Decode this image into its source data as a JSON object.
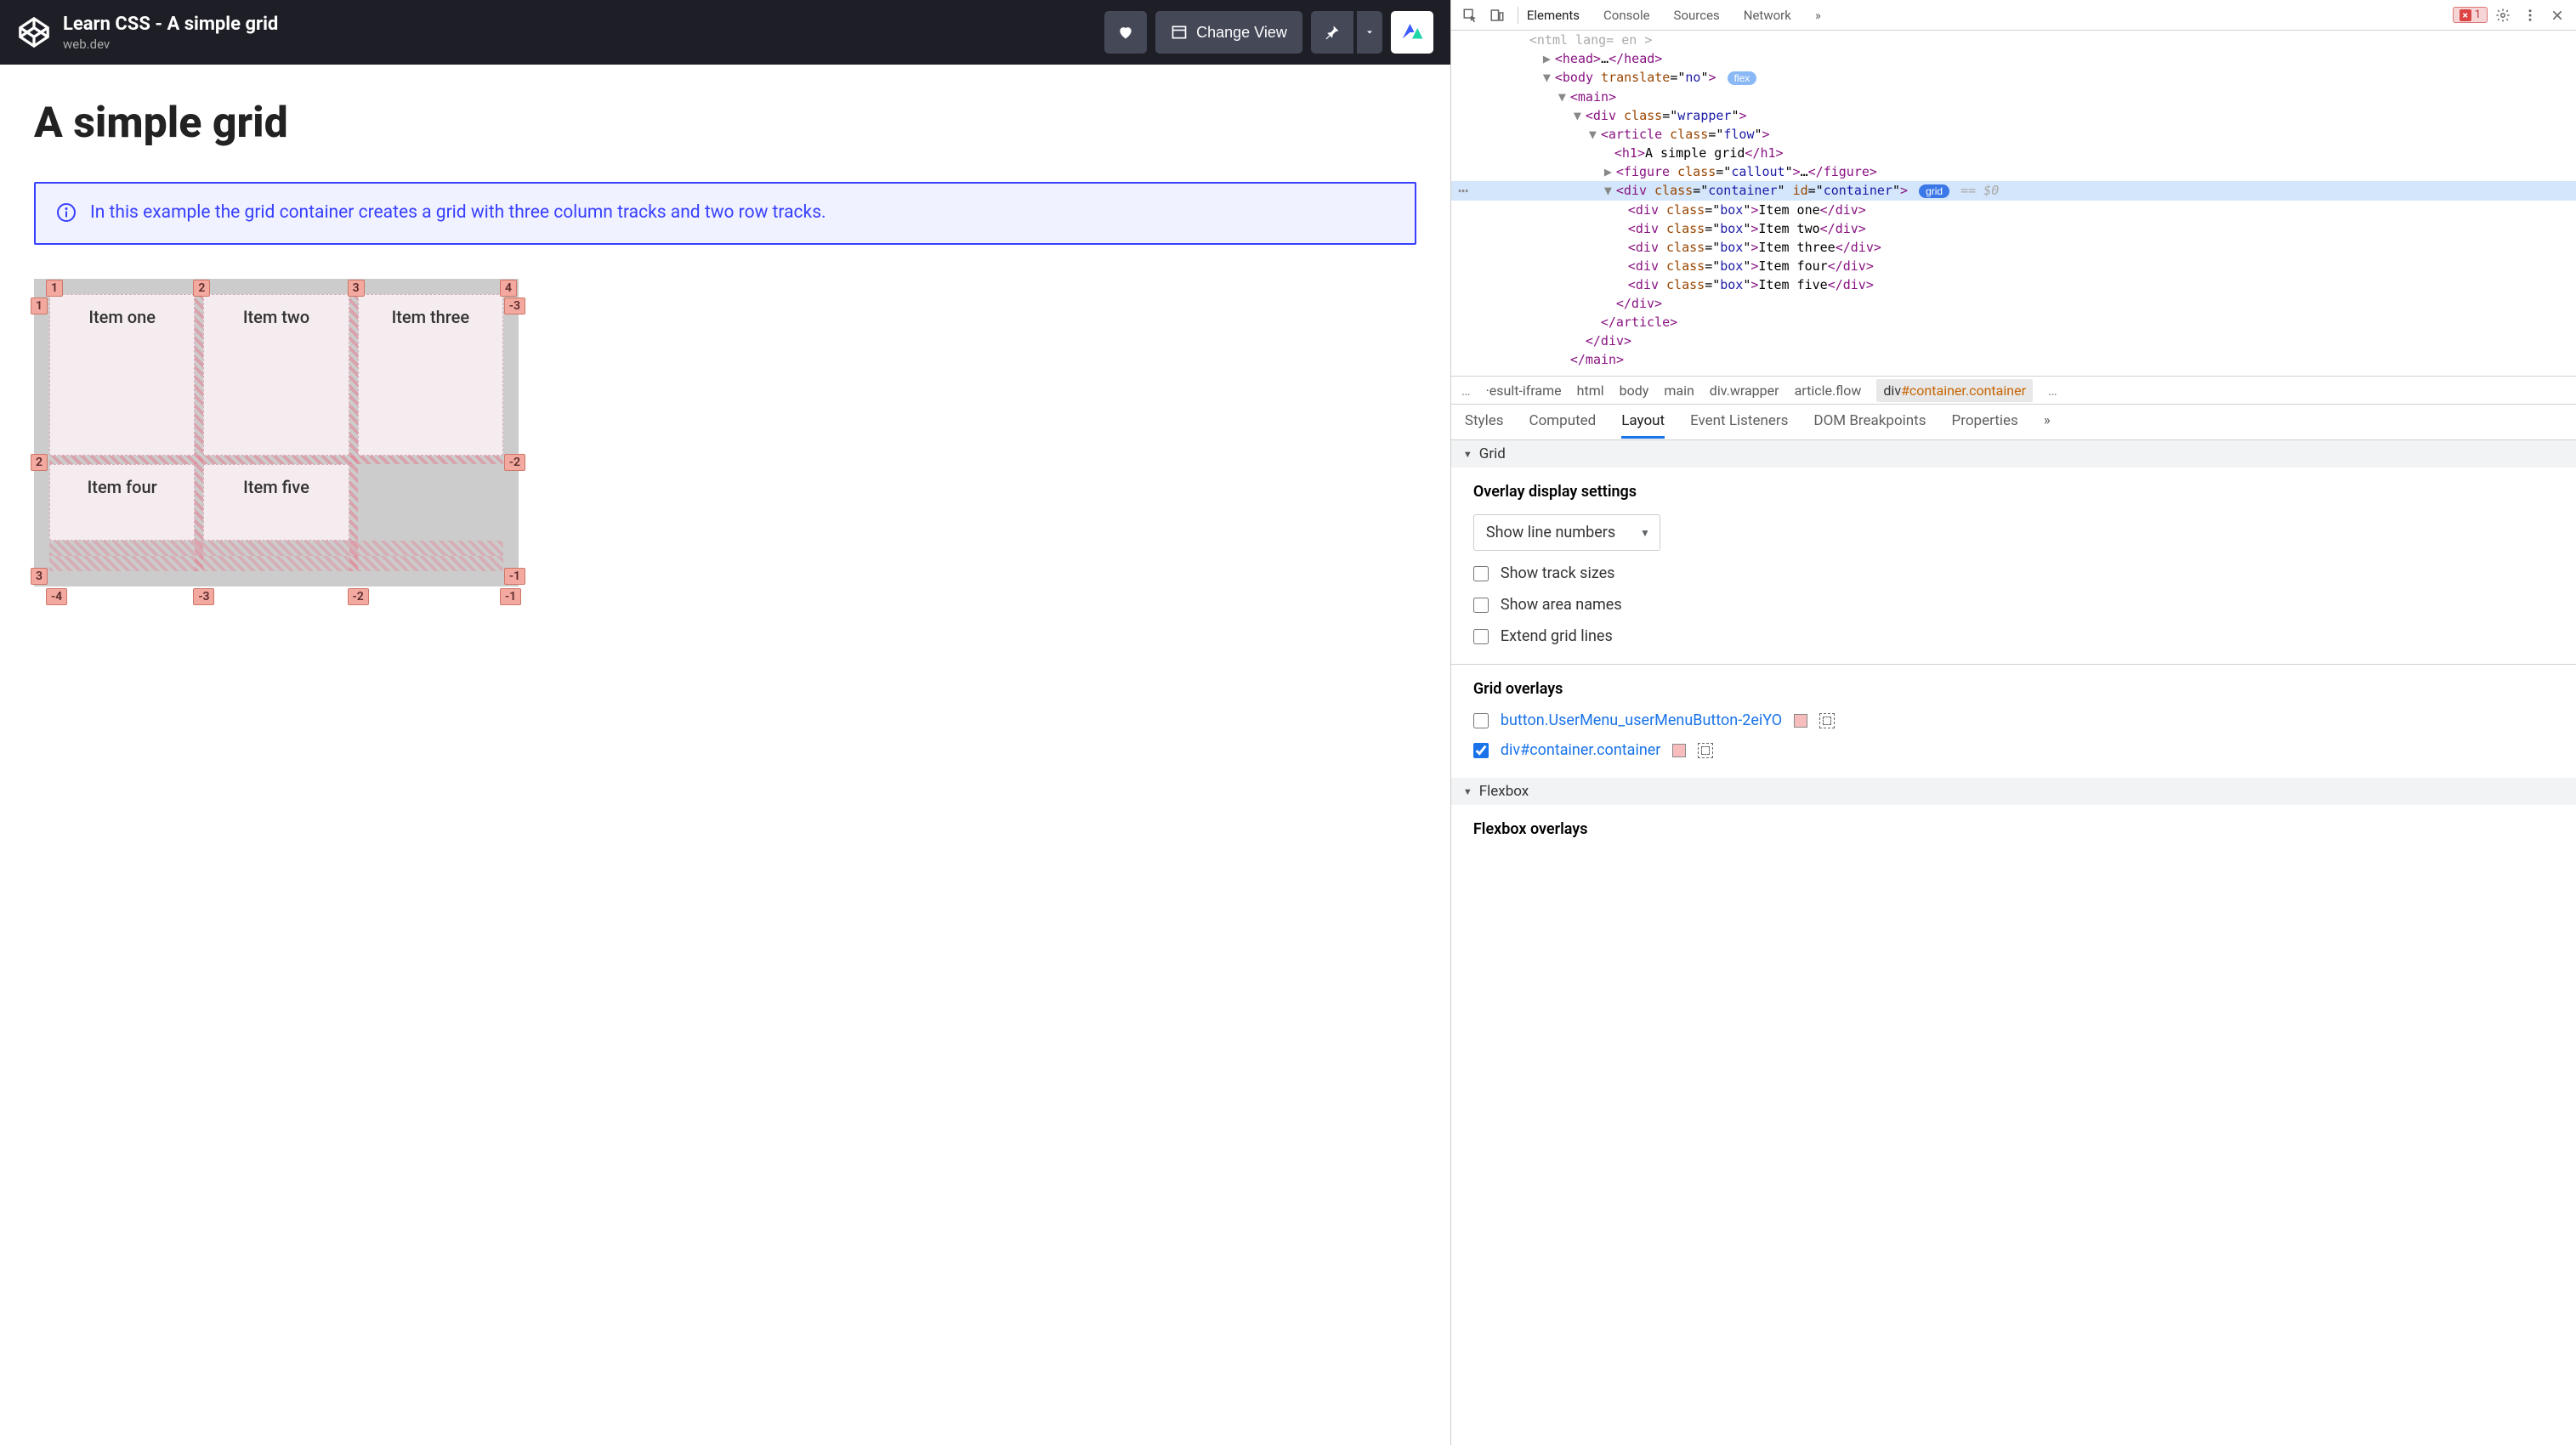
{
  "codepen": {
    "title": "Learn CSS - A simple grid",
    "subtitle": "web.dev",
    "change_view": "Change View"
  },
  "page": {
    "heading": "A simple grid",
    "callout": "In this example the grid container creates a grid with three column tracks and two row tracks.",
    "items": [
      "Item one",
      "Item two",
      "Item three",
      "Item four",
      "Item five"
    ],
    "col_labels_top": [
      "1",
      "2",
      "3",
      "4"
    ],
    "row_labels_left": [
      "1",
      "2",
      "3"
    ],
    "row_labels_right": [
      "-3",
      "-2",
      "-1"
    ],
    "col_labels_bottom": [
      "-4",
      "-3",
      "-2",
      "-1"
    ]
  },
  "devtools": {
    "tabs": [
      "Elements",
      "Console",
      "Sources",
      "Network"
    ],
    "active_tab": "Elements",
    "error_count": "1",
    "dom": {
      "lang": "en",
      "body_attr": "translate",
      "body_val": "no",
      "body_badge": "flex",
      "h1_text": "A simple grid",
      "figure_class": "callout",
      "container_text": "container",
      "container_badge": "grid",
      "eq0": " == $0",
      "box_items": [
        "Item one",
        "Item two",
        "Item three",
        "Item four",
        "Item five"
      ]
    },
    "breadcrumb": {
      "items": [
        "…",
        "·esult-iframe",
        "html",
        "body",
        "main",
        "div.wrapper",
        "article.flow"
      ],
      "selected_prefix": "div",
      "selected_id": "#container",
      "selected_cls": ".container",
      "trail_ell": "…"
    },
    "subtabs": [
      "Styles",
      "Computed",
      "Layout",
      "Event Listeners",
      "DOM Breakpoints",
      "Properties"
    ],
    "active_subtab": "Layout",
    "layout": {
      "grid_section": "Grid",
      "overlay_settings_title": "Overlay display settings",
      "select_value": "Show line numbers",
      "checkboxes": [
        "Show track sizes",
        "Show area names",
        "Extend grid lines"
      ],
      "overlays_title": "Grid overlays",
      "ov1": "button.UserMenu_userMenuButton-2eiYO",
      "ov2": "div#container.container",
      "flexbox_section": "Flexbox",
      "flexbox_overlays_title": "Flexbox overlays"
    }
  }
}
